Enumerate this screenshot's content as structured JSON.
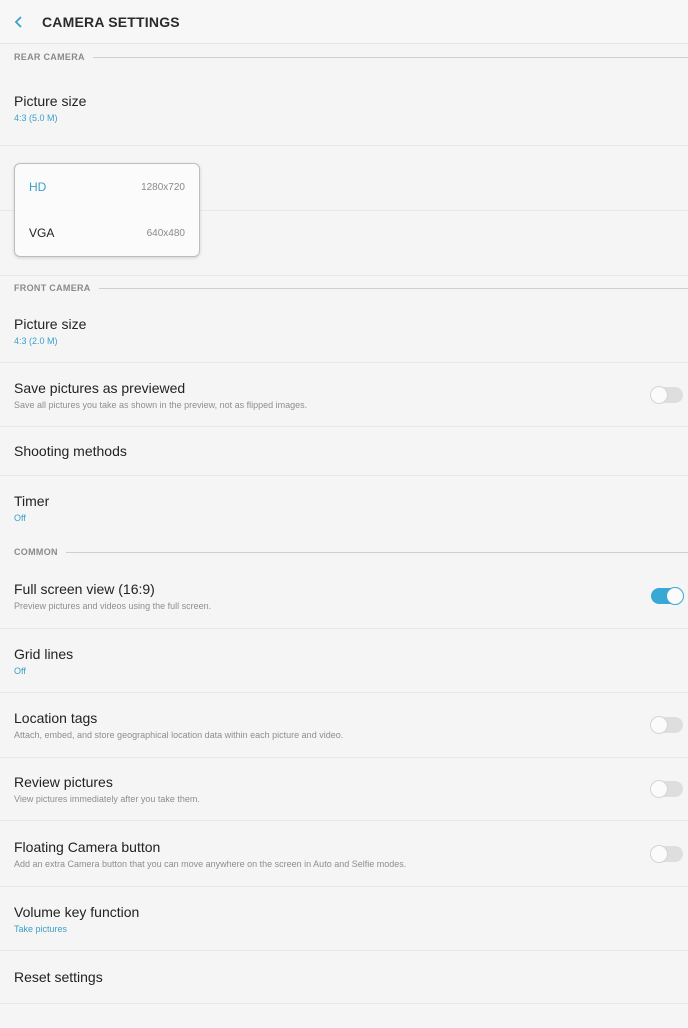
{
  "header": {
    "title": "CAMERA SETTINGS",
    "back_icon": "chevron-left-icon",
    "accent_color": "#3aa0c8"
  },
  "rear_camera": {
    "section_label": "REAR CAMERA",
    "picture_size": {
      "title": "Picture size",
      "value": "4:3 (5.0 M)"
    }
  },
  "video_size_popup": {
    "options": [
      {
        "name": "HD",
        "resolution": "1280x720",
        "selected": true
      },
      {
        "name": "VGA",
        "resolution": "640x480",
        "selected": false
      }
    ]
  },
  "front_camera": {
    "section_label": "FRONT CAMERA",
    "picture_size": {
      "title": "Picture size",
      "value": "4:3 (2.0 M)"
    },
    "save_as_previewed": {
      "title": "Save pictures as previewed",
      "description": "Save all pictures you take as shown in the preview, not as flipped images.",
      "enabled": false
    },
    "shooting_methods": {
      "title": "Shooting methods"
    },
    "timer": {
      "title": "Timer",
      "value": "Off"
    }
  },
  "common": {
    "section_label": "COMMON",
    "full_screen_view": {
      "title": "Full screen view (16:9)",
      "description": "Preview pictures and videos using the full screen.",
      "enabled": true
    },
    "grid_lines": {
      "title": "Grid lines",
      "value": "Off"
    },
    "location_tags": {
      "title": "Location tags",
      "description": "Attach, embed, and store geographical location data within each picture and video.",
      "enabled": false
    },
    "review_pictures": {
      "title": "Review pictures",
      "description": "View pictures immediately after you take them.",
      "enabled": false
    },
    "floating_camera_button": {
      "title": "Floating Camera button",
      "description": "Add an extra Camera button that you can move anywhere on the screen in Auto and Selfie modes.",
      "enabled": false
    },
    "volume_key_function": {
      "title": "Volume key function",
      "value": "Take pictures"
    },
    "reset_settings": {
      "title": "Reset settings"
    }
  }
}
